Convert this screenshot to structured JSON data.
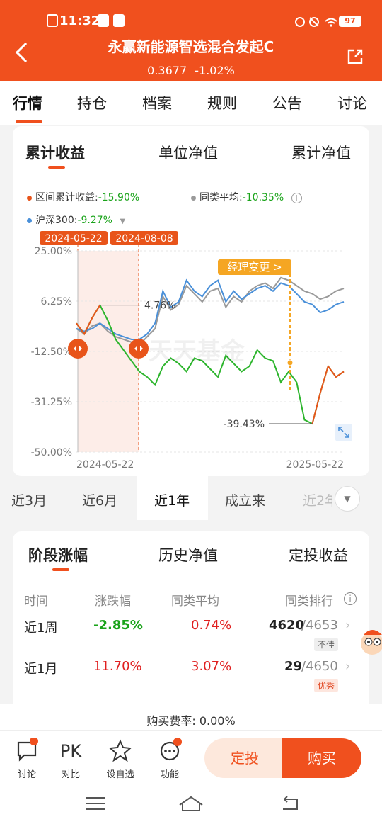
{
  "status": {
    "time": "11:32",
    "battery": "97"
  },
  "header": {
    "title": "永赢新能源智选混合发起C",
    "nav_value": "0.3677",
    "change": "-1.02%"
  },
  "tabs": [
    "行情",
    "持仓",
    "档案",
    "规则",
    "公告",
    "讨论"
  ],
  "chart_card": {
    "tabs": [
      "累计收益",
      "单位净值",
      "累计净值"
    ],
    "legend": {
      "fund_label": "区间累计收益:",
      "fund_value": "-15.90%",
      "avg_label": "同类平均:",
      "avg_value": "-10.35%",
      "index_label": "沪深300:",
      "index_value": "-9.27%"
    },
    "range_start": "2024-05-22",
    "range_end": "2024-08-08",
    "manager_change": "经理变更 >",
    "watermark": "天天基金",
    "callout_high": "4.76%",
    "callout_low": "-39.43%",
    "colors": {
      "fund": "#e8541a",
      "fund_green": "#2db52d",
      "avg": "#9a9a9a",
      "index": "#4a90d9",
      "accent": "#f0501e"
    }
  },
  "chart_data": {
    "type": "line",
    "yticks": [
      "25.00%",
      "6.25%",
      "-12.50%",
      "-31.25%",
      "-50.00%"
    ],
    "xticks": [
      "2024-05-22",
      "2025-05-22"
    ],
    "ylim": [
      -50,
      25
    ],
    "series": [
      {
        "name": "区间累计收益",
        "values": [
          -2,
          -6,
          0,
          4.76,
          -1,
          -8,
          -12,
          -16,
          -20,
          -22,
          -25,
          -18,
          -15,
          -17,
          -20,
          -15,
          -16,
          -19,
          -22,
          -14,
          -17,
          -20,
          -18,
          -12,
          -15,
          -16,
          -24,
          -20,
          -24,
          -38,
          -39.43,
          -28,
          -18,
          -22,
          -20
        ]
      },
      {
        "name": "同类平均",
        "values": [
          -4,
          -6,
          -3,
          -2,
          -5,
          -7,
          -8,
          -9,
          -10,
          -7,
          -4,
          8,
          3,
          5,
          12,
          9,
          6,
          10,
          11,
          4,
          8,
          6,
          10,
          12,
          13,
          11,
          15,
          14,
          12,
          10,
          9,
          7,
          8,
          10,
          11
        ]
      },
      {
        "name": "沪深300",
        "values": [
          -4,
          -5,
          -4,
          -2,
          -4,
          -6,
          -7,
          -8,
          -8,
          -6,
          -2,
          10,
          4,
          6,
          14,
          10,
          8,
          12,
          14,
          6,
          10,
          7,
          9,
          11,
          12,
          10,
          13,
          12,
          9,
          6,
          5,
          2,
          3,
          5,
          6
        ]
      }
    ]
  },
  "ranges": [
    "近3月",
    "近6月",
    "近1年",
    "成立来",
    "近2年"
  ],
  "perf_card": {
    "tabs": [
      "阶段涨幅",
      "历史净值",
      "定投收益"
    ],
    "headers": [
      "时间",
      "涨跌幅",
      "同类平均",
      "同类排行"
    ],
    "rows": [
      {
        "period": "近1周",
        "change": "-2.85%",
        "avg": "0.74%",
        "rank": "4620",
        "total": "/4653",
        "badge": "不佳"
      },
      {
        "period": "近1月",
        "change": "11.70%",
        "avg": "3.07%",
        "rank": "29",
        "total": "/4650",
        "badge": "优秀"
      }
    ]
  },
  "bottom": {
    "fee": "购买费率: 0.00%",
    "items": [
      {
        "icon": "chat-icon",
        "label": "讨论"
      },
      {
        "icon": "pk-icon",
        "glyph": "PK",
        "label": "对比"
      },
      {
        "icon": "star-icon",
        "label": "设自选"
      },
      {
        "icon": "more-icon",
        "label": "功能"
      }
    ],
    "btn_dingtou": "定投",
    "btn_buy": "购买"
  }
}
